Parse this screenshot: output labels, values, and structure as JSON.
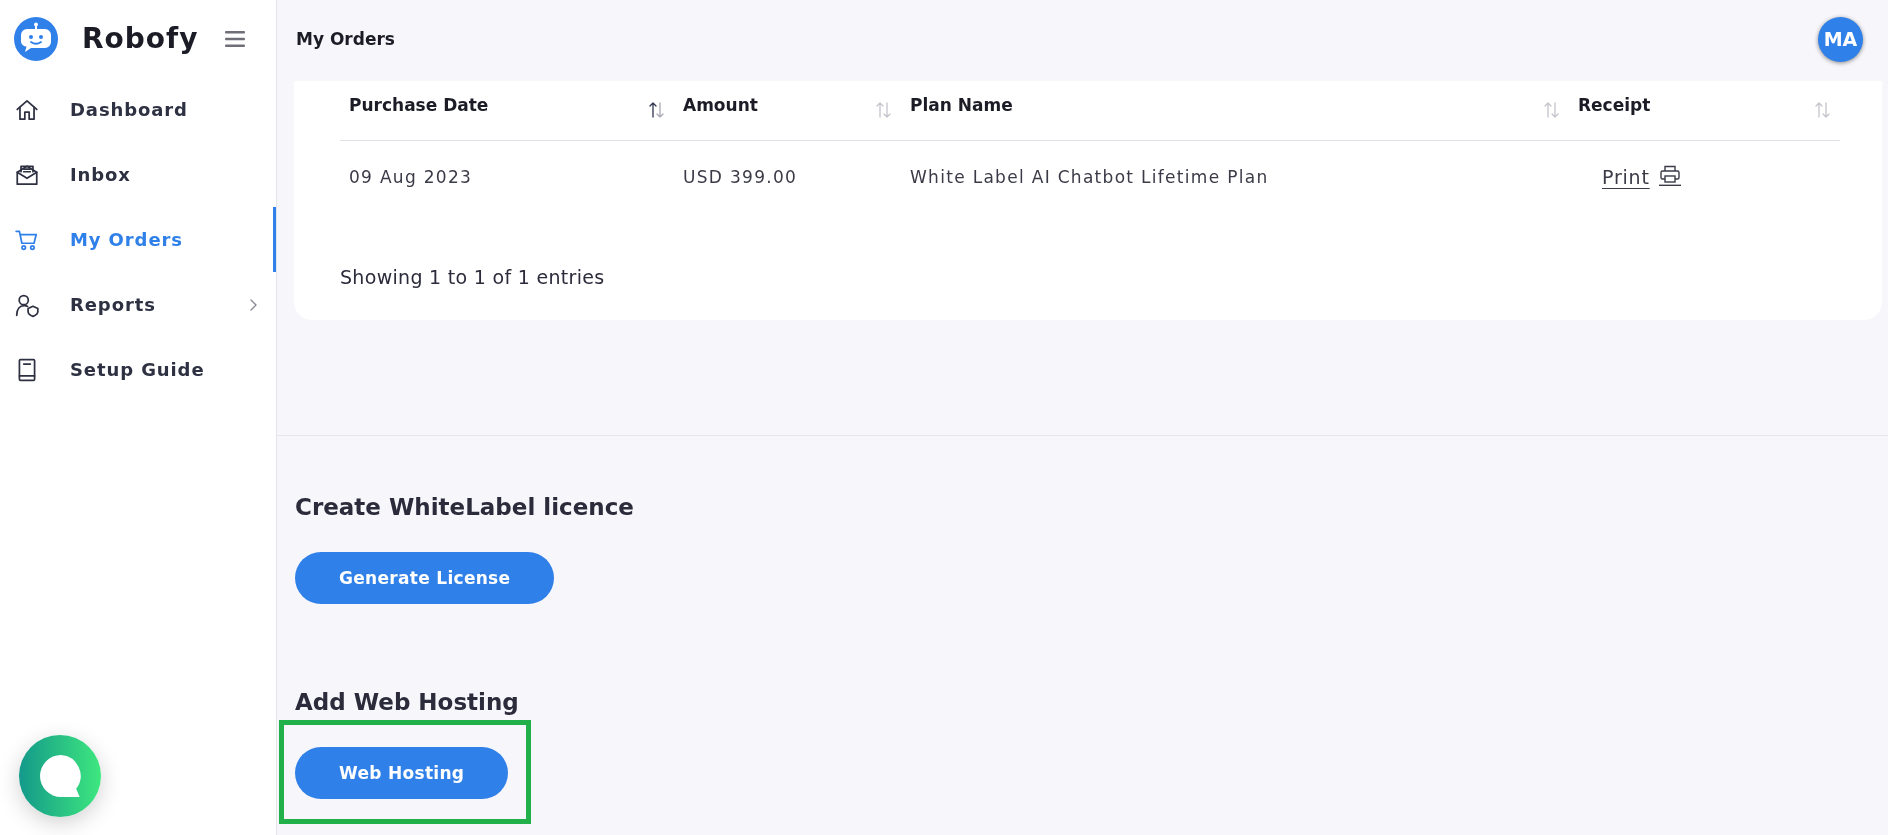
{
  "app": {
    "name": "Robofy"
  },
  "sidebar": {
    "items": [
      {
        "label": "Dashboard",
        "selected": false,
        "expandable": false
      },
      {
        "label": "Inbox",
        "selected": false,
        "expandable": false
      },
      {
        "label": "My Orders",
        "selected": true,
        "expandable": false
      },
      {
        "label": "Reports",
        "selected": false,
        "expandable": true
      },
      {
        "label": "Setup Guide",
        "selected": false,
        "expandable": false
      }
    ]
  },
  "header": {
    "title": "My Orders",
    "avatar_initials": "MA"
  },
  "orders_table": {
    "columns": [
      {
        "label": "Purchase Date",
        "sorted": true
      },
      {
        "label": "Amount",
        "sorted": false
      },
      {
        "label": "Plan Name",
        "sorted": false
      },
      {
        "label": "Receipt",
        "sorted": false
      }
    ],
    "rows": [
      {
        "cells": [
          {
            "kind": "text",
            "text": "09 Aug 2023"
          },
          {
            "kind": "text",
            "text": "USD 399.00"
          },
          {
            "kind": "text",
            "text": "White Label AI Chatbot Lifetime Plan"
          },
          {
            "kind": "print_link",
            "text": "Print"
          }
        ]
      }
    ],
    "info": "Showing 1 to 1 of 1 entries"
  },
  "sections": [
    {
      "title": "Create WhiteLabel licence",
      "button": {
        "label": "Generate License",
        "highlighted": false
      }
    },
    {
      "title": "Add Web Hosting",
      "button": {
        "label": "Web Hosting",
        "highlighted": true
      }
    }
  ]
}
